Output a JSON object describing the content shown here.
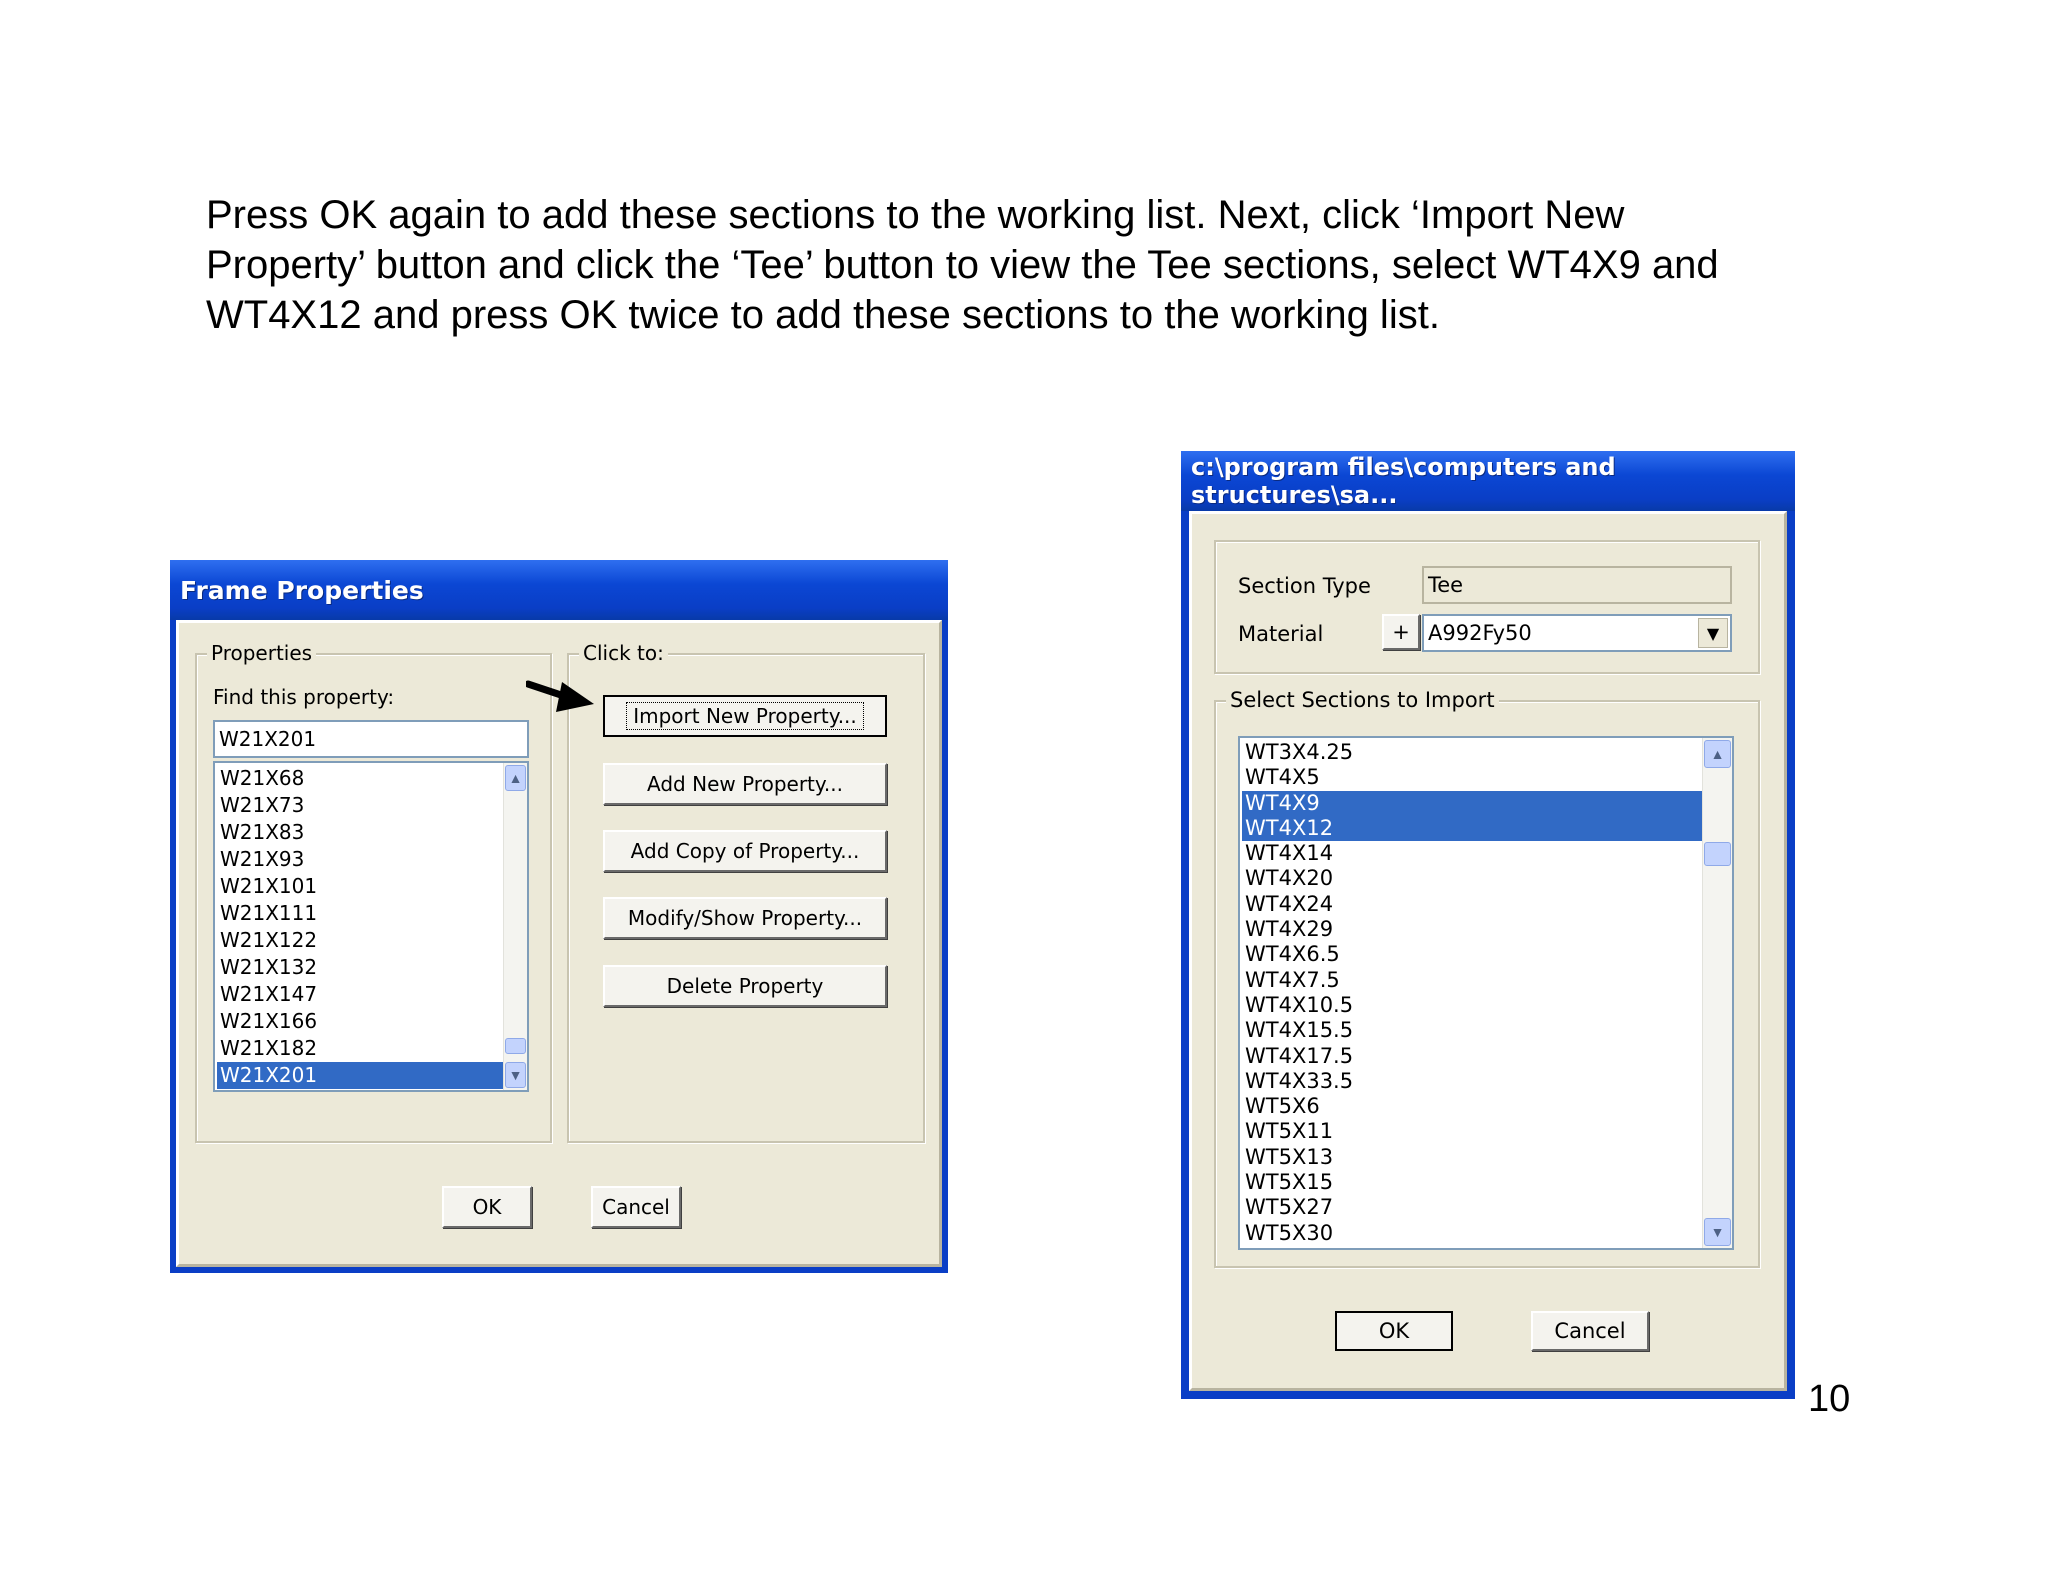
{
  "instructions": {
    "line1": "Press OK again to add these sections to the working list. Next, click ‘Import New",
    "line2": "Property’ button and click the ‘Tee’ button to view the Tee sections, select WT4X9 and",
    "line3": "WT4X12 and press OK twice to add these sections to the working list."
  },
  "page_number": "10",
  "frame_properties": {
    "title": "Frame Properties",
    "properties_group": "Properties",
    "find_label": "Find this property:",
    "find_value": "W21X201",
    "list": [
      "W21X68",
      "W21X73",
      "W21X83",
      "W21X93",
      "W21X101",
      "W21X111",
      "W21X122",
      "W21X132",
      "W21X147",
      "W21X166",
      "W21X182",
      "W21X201"
    ],
    "selected": "W21X201",
    "click_to_group": "Click to:",
    "buttons": {
      "import": "Import New Property...",
      "add_new": "Add New Property...",
      "add_copy": "Add Copy of Property...",
      "modify": "Modify/Show Property...",
      "delete": "Delete Property"
    },
    "ok": "OK",
    "cancel": "Cancel"
  },
  "import_dialog": {
    "title": "c:\\program files\\computers and structures\\sa...",
    "section_type_label": "Section Type",
    "section_type_value": "Tee",
    "material_label": "Material",
    "material_plus": "+",
    "material_value": "A992Fy50",
    "select_group": "Select Sections to Import",
    "list": [
      "WT3X4.25",
      "WT4X5",
      "WT4X9",
      "WT4X12",
      "WT4X14",
      "WT4X20",
      "WT4X24",
      "WT4X29",
      "WT4X6.5",
      "WT4X7.5",
      "WT4X10.5",
      "WT4X15.5",
      "WT4X17.5",
      "WT4X33.5",
      "WT5X6",
      "WT5X11",
      "WT5X13",
      "WT5X15",
      "WT5X27",
      "WT5X30"
    ],
    "selected": [
      "WT4X9",
      "WT4X12"
    ],
    "ok": "OK",
    "cancel": "Cancel"
  },
  "icons": {
    "scroll_up": "scroll-up-icon",
    "scroll_down": "scroll-down-icon",
    "dropdown": "chevron-down-icon",
    "pointer": "arrow-pointer-icon"
  },
  "colors": {
    "title_bar": "#0a3ec6",
    "dialog_face": "#ece9d8",
    "selection": "#316ac5"
  }
}
